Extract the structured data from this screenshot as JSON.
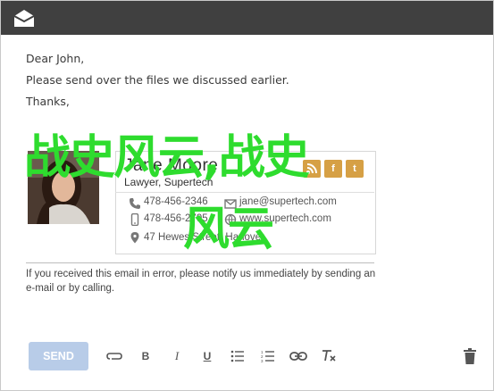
{
  "email": {
    "lines": [
      "Dear John,",
      "Please send over the files we discussed earlier.",
      "Thanks,"
    ]
  },
  "signature": {
    "name": "Jane Moore",
    "title": "Lawyer, Supertech",
    "social": [
      "rss",
      "facebook",
      "twitter"
    ],
    "contacts": [
      {
        "icon": "phone-icon",
        "text": "478-456-2346"
      },
      {
        "icon": "mail-icon",
        "text": "jane@supertech.com"
      },
      {
        "icon": "mobile-icon",
        "text": "478-456-2795"
      },
      {
        "icon": "web-icon",
        "text": "www.supertech.com"
      },
      {
        "icon": "location-icon",
        "text": "47 Hewes Street, Hanover"
      }
    ]
  },
  "watermark": {
    "line1": "战史风云,战史",
    "line2": "风云"
  },
  "disclaimer": "If you received this email in error, please notify us immediately by sending an e-mail or by calling.",
  "toolbar": {
    "send_label": "SEND"
  },
  "colors": {
    "titlebar": "#404040",
    "send_button": "#b8cce8",
    "social_icon": "#d6a045",
    "watermark": "#2edc2e"
  }
}
